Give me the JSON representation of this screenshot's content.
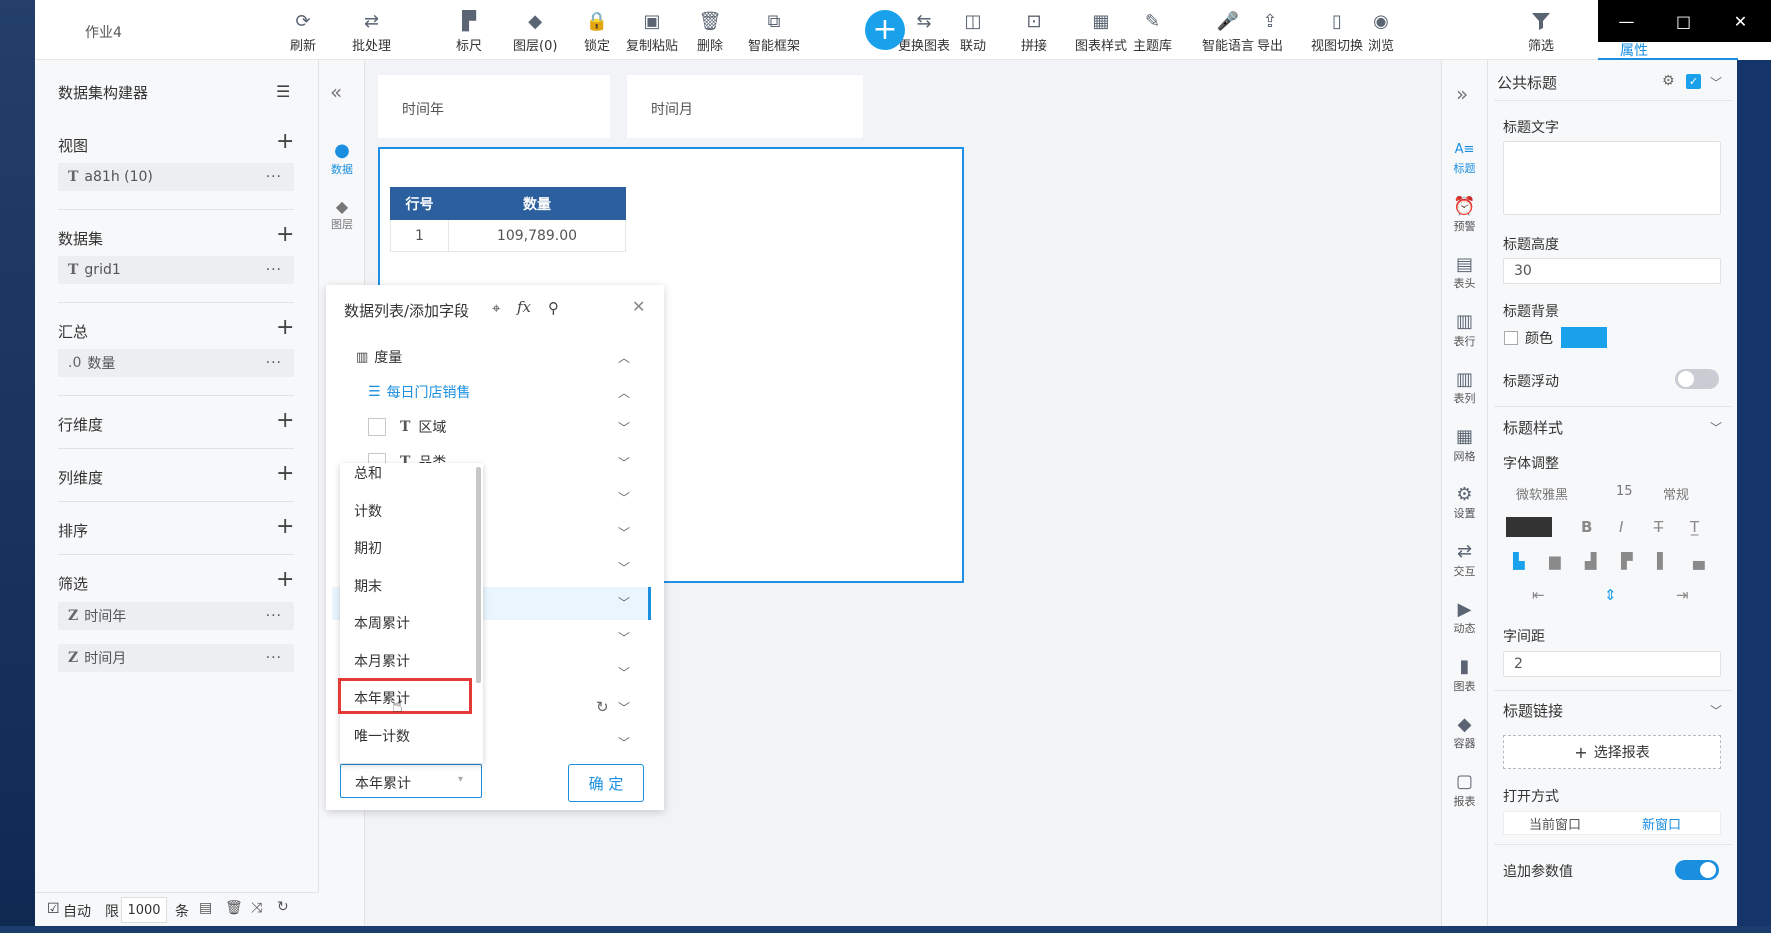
{
  "window": {
    "title": "作业4",
    "min": "—",
    "max": "□",
    "close": "✕"
  },
  "toolbar": {
    "items": [
      {
        "label": "刷新",
        "icon": "refresh-icon"
      },
      {
        "label": "批处理",
        "icon": "batch-icon"
      },
      {
        "label": "标尺",
        "icon": "ruler-icon"
      },
      {
        "label": "图层(0)",
        "icon": "layers-icon"
      },
      {
        "label": "锁定",
        "icon": "lock-icon"
      },
      {
        "label": "复制粘贴",
        "icon": "copy-icon"
      },
      {
        "label": "删除",
        "icon": "trash-icon"
      },
      {
        "label": "智能框架",
        "icon": "frame-icon"
      },
      {
        "label": "更换图表",
        "icon": "swap-chart-icon"
      },
      {
        "label": "联动",
        "icon": "link-icon"
      },
      {
        "label": "拼接",
        "icon": "splice-icon"
      },
      {
        "label": "图表样式",
        "icon": "chart-style-icon"
      },
      {
        "label": "主题库",
        "icon": "brush-icon"
      },
      {
        "label": "智能语言",
        "icon": "microphone-icon"
      },
      {
        "label": "导出",
        "icon": "export-icon"
      },
      {
        "label": "视图切换",
        "icon": "device-icon"
      },
      {
        "label": "浏览",
        "icon": "eye-icon"
      }
    ],
    "add": "+",
    "filter_label": "筛选",
    "property_label": "属性"
  },
  "left_panel": {
    "title": "数据集构建器",
    "sections": {
      "view": {
        "label": "视图",
        "field": "a81h (10)"
      },
      "dataset": {
        "label": "数据集",
        "field": "grid1"
      },
      "summary": {
        "label": "汇总",
        "field": "数量",
        "prefix": ".0"
      },
      "row_dim": {
        "label": "行维度"
      },
      "col_dim": {
        "label": "列维度"
      },
      "sort": {
        "label": "排序"
      },
      "filter": {
        "label": "筛选",
        "fields": [
          "时间年",
          "时间月"
        ]
      }
    },
    "footer": {
      "auto": "自动",
      "limit": "限",
      "limit_value": "1000",
      "unit": "条"
    }
  },
  "strip": {
    "data": "数据",
    "layer": "图层"
  },
  "canvas": {
    "filters": [
      "时间年",
      "时间月"
    ],
    "table": {
      "headers": [
        "行号",
        "数量"
      ],
      "rows": [
        [
          "1",
          "109,789.00"
        ]
      ]
    }
  },
  "field_list": {
    "title": "数据列表/添加字段",
    "measure": "度量",
    "table_name": "每日门店销售",
    "fields": [
      "区域",
      "品类"
    ],
    "agg_options": [
      "总和",
      "计数",
      "期初",
      "期末",
      "本周累计",
      "本月累计",
      "本年累计",
      "唯一计数"
    ],
    "agg_selected": "本年累计",
    "ok": "确 定"
  },
  "right_icons": [
    "标题",
    "预警",
    "表头",
    "表行",
    "表列",
    "网格",
    "设置",
    "交互",
    "动态",
    "图表",
    "容器",
    "报表"
  ],
  "properties": {
    "header": "公共标题",
    "title_text_label": "标题文字",
    "title_height_label": "标题高度",
    "title_height": "30",
    "title_bg_label": "标题背景",
    "color_label": "颜色",
    "bg_color": "#1aa1ec",
    "float_label": "标题浮动",
    "style_label": "标题样式",
    "font_adjust_label": "字体调整",
    "font_name": "微软雅黑",
    "font_size": "15",
    "font_weight": "常规",
    "spacing_label": "字间距",
    "spacing": "2",
    "link_label": "标题链接",
    "select_report": "选择报表",
    "open_mode_label": "打开方式",
    "open_current": "当前窗口",
    "open_new": "新窗口",
    "append_param_label": "追加参数值"
  }
}
